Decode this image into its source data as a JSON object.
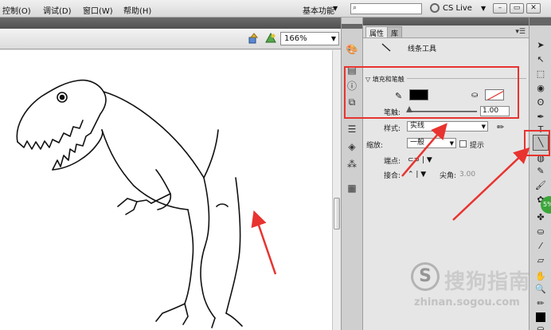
{
  "menu": {
    "items": [
      "控制(O)",
      "调试(D)",
      "窗口(W)",
      "帮助(H)"
    ],
    "workspace": "基本功能",
    "search_icon": "search-icon",
    "cslive": "CS Live",
    "window_buttons": [
      "minimize",
      "restore",
      "close"
    ]
  },
  "doc": {
    "zoom": "166%",
    "edit_symbol_icon": "edit-symbol-icon",
    "edit_scene_icon": "edit-scene-icon"
  },
  "panel": {
    "tabs": [
      "属性",
      "库"
    ],
    "active_tab": "属性",
    "tool_name": "线条工具",
    "section_title": "填充和笔触",
    "stroke_color": "#000000",
    "fill_color": "none",
    "stroke_label": "笔触:",
    "stroke_value": "1.00",
    "style_label": "样式:",
    "style_value": "实线",
    "scale_label": "缩放:",
    "scale_value": "一般",
    "hint_label": "提示",
    "cap_label": "端点:",
    "join_label": "接合:",
    "miter_label": "尖角:",
    "miter_value": "3.00"
  },
  "tools": {
    "selected": "line-tool"
  },
  "annotations": {
    "accent_color": "#e8332f"
  },
  "watermark": {
    "logo_letter": "S",
    "text": "搜狗指南",
    "url": "zhinan.sogou.com"
  },
  "badge": {
    "text": "5%"
  }
}
